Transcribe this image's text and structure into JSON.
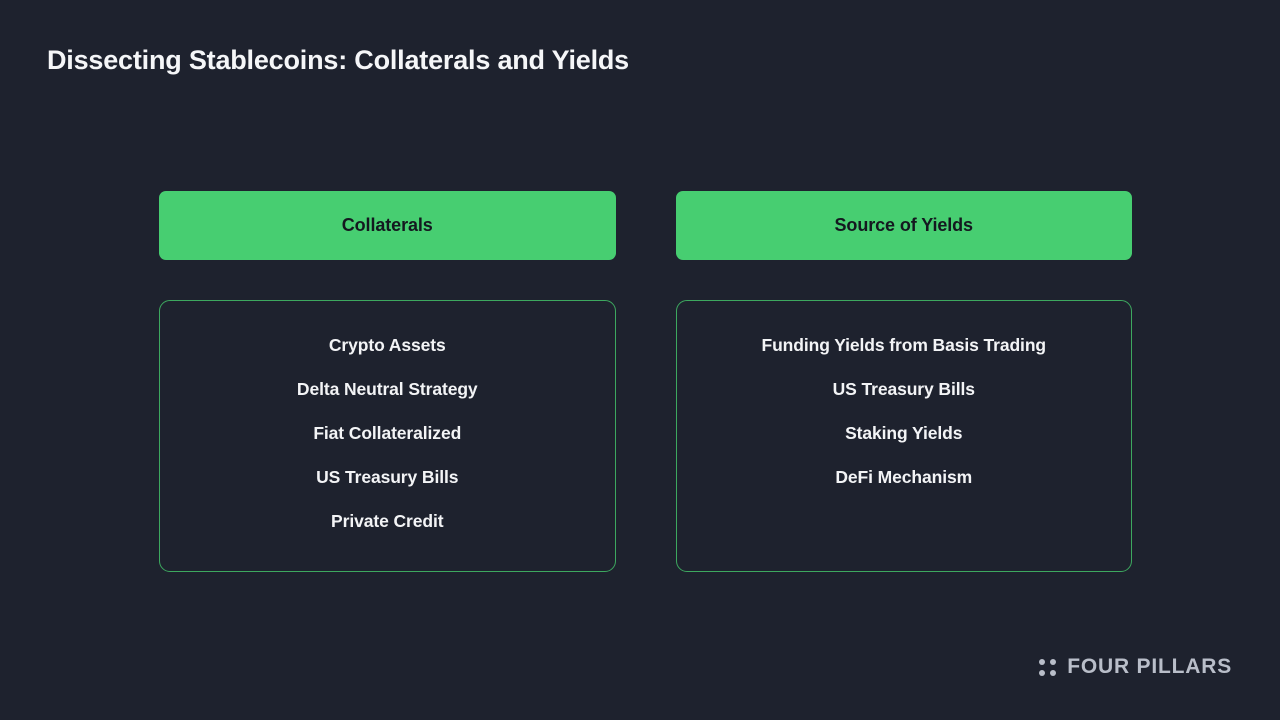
{
  "slide": {
    "title": "Dissecting Stablecoins: Collaterals and Yields",
    "background_color": "#1e222e",
    "accent_color": "#47ce71",
    "border_color": "#3da85f",
    "text_color": "#f3f4f6"
  },
  "columns": [
    {
      "header": "Collaterals",
      "items": [
        "Crypto Assets",
        "Delta Neutral Strategy",
        "Fiat Collateralized",
        "US Treasury Bills",
        "Private Credit"
      ]
    },
    {
      "header": "Source of Yields",
      "items": [
        "Funding Yields from Basis Trading",
        "US Treasury Bills",
        "Staking Yields",
        "DeFi Mechanism"
      ]
    }
  ],
  "brand": {
    "name": "FOUR PILLARS",
    "icon": "four-dots-icon",
    "color": "#b9bec9"
  }
}
